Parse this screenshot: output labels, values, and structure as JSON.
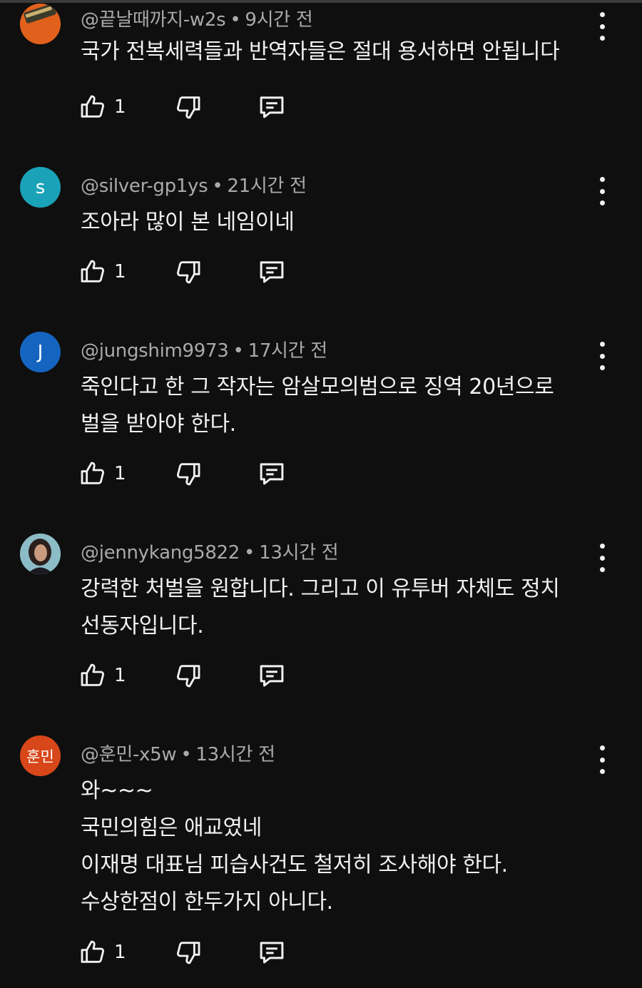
{
  "comments": [
    {
      "author": "@끝날때까지-w2s",
      "time": "9시간 전",
      "lines": [
        "국가 전복세력들과 반역자들은 절대 용서하면 안됩니다"
      ],
      "likes": "1",
      "avatar_letter": "",
      "avatar_color": "#e05a1a"
    },
    {
      "author": "@silver-gp1ys",
      "time": "21시간 전",
      "lines": [
        "조아라 많이 본 네임이네"
      ],
      "likes": "1",
      "avatar_letter": "s",
      "avatar_color": "#1aa3b8"
    },
    {
      "author": "@jungshim9973",
      "time": "17시간 전",
      "lines": [
        "죽인다고 한 그 작자는 암살모의범으로 징역 20년으로",
        "벌을 받아야 한다."
      ],
      "likes": "1",
      "avatar_letter": "J",
      "avatar_color": "#1565c0"
    },
    {
      "author": "@jennykang5822",
      "time": "13시간 전",
      "lines": [
        "강력한 처벌을 원합니다. 그리고 이 유투버 자체도 정치",
        "선동자입니다."
      ],
      "likes": "1",
      "avatar_letter": "",
      "avatar_color": "#6fa7b5"
    },
    {
      "author": "@훈민-x5w",
      "time": "13시간 전",
      "lines": [
        "와~~~",
        "국민의힘은 애교였네",
        "이재명 대표님 피습사건도 철저히 조사해야 한다.",
        "수상한점이 한두가지 아니다."
      ],
      "likes": "1",
      "avatar_letter": "훈민",
      "avatar_color": "#d8471a"
    }
  ],
  "icons": {
    "like": "thumb-up-icon",
    "dislike": "thumb-down-icon",
    "reply": "reply-comment-icon",
    "more": "more-vertical-icon"
  },
  "colors": {
    "background": "#0f0f0f",
    "text": "#f1f1f1",
    "meta": "#aaaaaa"
  }
}
